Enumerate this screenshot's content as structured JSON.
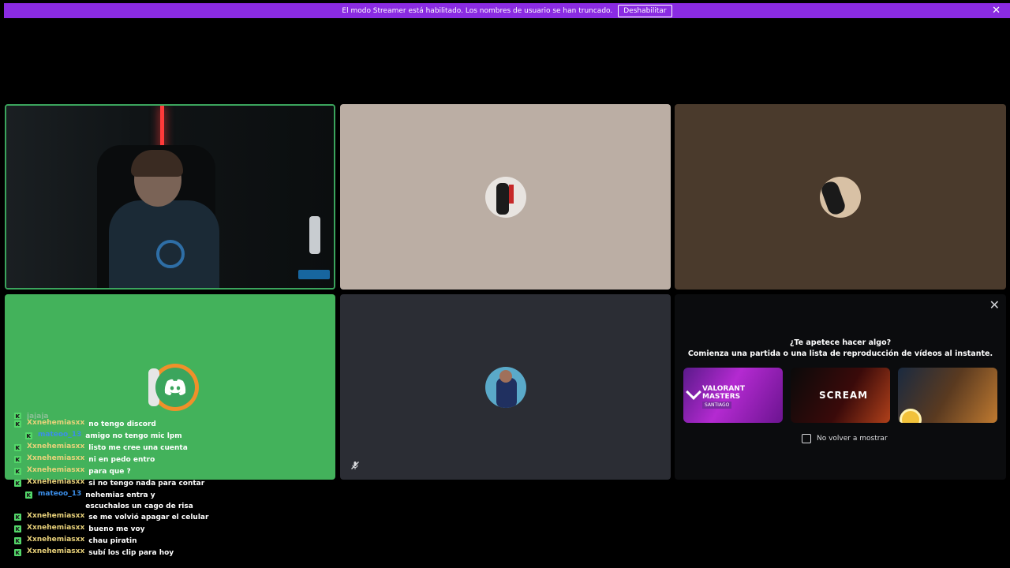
{
  "banner": {
    "message": "El modo Streamer está habilitado. Los nombres de usuario se han truncado.",
    "disable_label": "Deshabilitar",
    "close_glyph": "✕",
    "color": "#8a2be2"
  },
  "tiles": [
    {
      "id": "camera",
      "speaking": true,
      "speaking_color": "#3ba55d"
    },
    {
      "id": "avatar-2",
      "bg": "#bbaea4"
    },
    {
      "id": "avatar-3",
      "bg": "#4a3a2c"
    },
    {
      "id": "discord-avatar",
      "bg": "#43b25b"
    },
    {
      "id": "avatar-5",
      "bg": "#2b2d34",
      "muted": true
    }
  ],
  "activity": {
    "title": "¿Te apetece hacer algo?",
    "subtitle": "Comienza una partida o una lista de reproducción de vídeos al instante.",
    "close_glyph": "✕",
    "cards": [
      {
        "name": "VALORANT MASTERS",
        "tag": "SANTIAGO"
      },
      {
        "name": "SCREAM"
      },
      {
        "name": ""
      }
    ],
    "dont_show_label": "No volver a mostrar"
  },
  "chat": {
    "partial_top": "jajaja",
    "messages": [
      {
        "user": "Xxnehemiasxx",
        "text": "no tengo discord",
        "indent": false,
        "color": "gold"
      },
      {
        "user": "mateoo_13",
        "text": "amigo no tengo mic lpm",
        "indent": true,
        "color": "blue"
      },
      {
        "user": "Xxnehemiasxx",
        "text": "listo me cree una cuenta",
        "indent": false,
        "color": "gold"
      },
      {
        "user": "Xxnehemiasxx",
        "text": "ni en pedo entro",
        "indent": false,
        "color": "gold"
      },
      {
        "user": "Xxnehemiasxx",
        "text": "para que ?",
        "indent": false,
        "color": "gold"
      },
      {
        "user": "Xxnehemiasxx",
        "text": "si no tengo nada para contar",
        "indent": false,
        "color": "gold"
      },
      {
        "user": "mateoo_13",
        "text": "nehemias entra y escuchalos un cago de risa",
        "indent": true,
        "color": "blue"
      },
      {
        "user": "Xxnehemiasxx",
        "text": "se me volvió apagar el celular",
        "indent": false,
        "color": "gold"
      },
      {
        "user": "Xxnehemiasxx",
        "text": "bueno me voy",
        "indent": false,
        "color": "gold"
      },
      {
        "user": "Xxnehemiasxx",
        "text": "chau piratin",
        "indent": false,
        "color": "gold"
      },
      {
        "user": "Xxnehemiasxx",
        "text": "subí los clip para hoy",
        "indent": false,
        "color": "gold"
      }
    ]
  }
}
